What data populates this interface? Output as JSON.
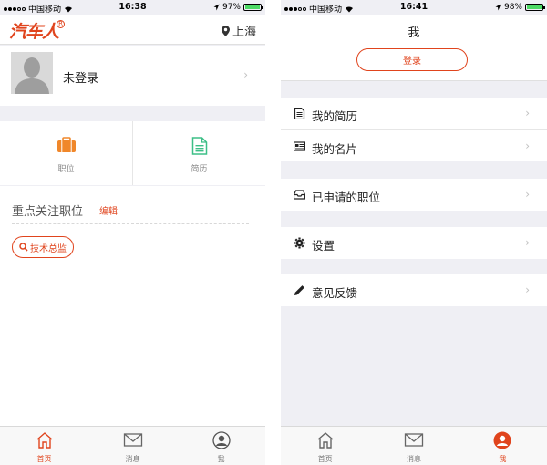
{
  "left": {
    "status": {
      "carrier": "中国移动",
      "time": "16:38",
      "battery": "97%",
      "battery_level": 0.97
    },
    "header": {
      "logo": "汽车人",
      "logo_mark": "R",
      "city": "上海"
    },
    "profile": {
      "name": "未登录"
    },
    "quick_actions": [
      {
        "label": "职位",
        "icon": "briefcase-icon",
        "color": "#f0872a"
      },
      {
        "label": "简历",
        "icon": "resume-icon",
        "color": "#3dbf87"
      }
    ],
    "focus": {
      "title": "重点关注职位",
      "edit_label": "编辑",
      "tag": "技术总监"
    },
    "tabbar": [
      {
        "label": "首页",
        "icon": "home-icon",
        "active": true
      },
      {
        "label": "消息",
        "icon": "mail-icon",
        "active": false
      },
      {
        "label": "我",
        "icon": "user-icon",
        "active": false
      }
    ]
  },
  "right": {
    "status": {
      "carrier": "中国移动",
      "time": "16:41",
      "battery": "98%",
      "battery_level": 0.98
    },
    "header": {
      "title": "我",
      "login_label": "登录"
    },
    "menu": [
      {
        "label": "我的简历",
        "icon": "document-icon"
      },
      {
        "label": "我的名片",
        "icon": "card-icon"
      },
      {
        "label": "已申请的职位",
        "icon": "inbox-icon"
      },
      {
        "label": "设置",
        "icon": "gear-icon"
      },
      {
        "label": "意见反馈",
        "icon": "pencil-icon"
      }
    ],
    "tabbar": [
      {
        "label": "首页",
        "icon": "home-icon",
        "active": false
      },
      {
        "label": "消息",
        "icon": "mail-icon",
        "active": false
      },
      {
        "label": "我",
        "icon": "user-icon",
        "active": true
      }
    ]
  },
  "colors": {
    "accent": "#e0441d",
    "briefcase": "#f0872a",
    "resume": "#3dbf87",
    "background": "#efeff4"
  }
}
